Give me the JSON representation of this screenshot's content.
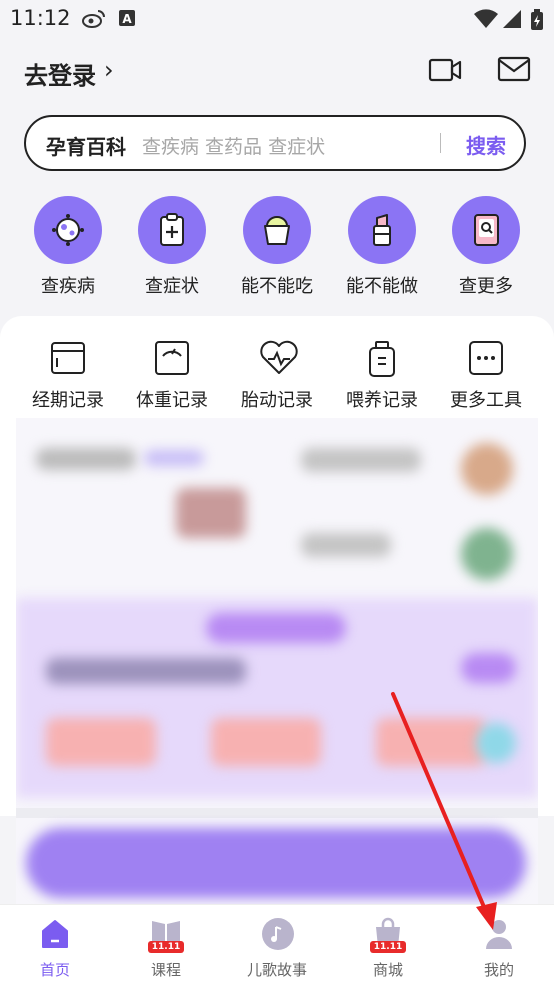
{
  "status_bar": {
    "time": "11:12"
  },
  "header": {
    "login_label": "去登录",
    "chevron": "›"
  },
  "search": {
    "brand": "孕育百科",
    "placeholder": "查疾病 查药品 查症状",
    "button_label": "搜索"
  },
  "quick_actions": [
    {
      "label": "查疾病",
      "icon": "virus-icon"
    },
    {
      "label": "查症状",
      "icon": "clipboard-plus-icon"
    },
    {
      "label": "能不能吃",
      "icon": "ice-cream-icon"
    },
    {
      "label": "能不能做",
      "icon": "lipstick-icon"
    },
    {
      "label": "查更多",
      "icon": "book-search-icon"
    }
  ],
  "tools": [
    {
      "label": "经期记录",
      "icon": "calendar-icon"
    },
    {
      "label": "体重记录",
      "icon": "scale-icon"
    },
    {
      "label": "胎动记录",
      "icon": "heartbeat-icon"
    },
    {
      "label": "喂养记录",
      "icon": "bottle-icon"
    },
    {
      "label": "更多工具",
      "icon": "more-icon"
    }
  ],
  "tabbar": {
    "items": [
      {
        "label": "首页",
        "icon": "home-icon",
        "active": true
      },
      {
        "label": "课程",
        "icon": "book-icon",
        "badge": "11.11"
      },
      {
        "label": "儿歌故事",
        "icon": "music-icon"
      },
      {
        "label": "商城",
        "icon": "bag-icon",
        "badge": "11.11"
      },
      {
        "label": "我的",
        "icon": "user-icon"
      }
    ]
  },
  "colors": {
    "accent": "#7b5cf0",
    "icon_circle": "#8b74f4",
    "badge": "#e82b2b",
    "arrow": "#e82020"
  }
}
